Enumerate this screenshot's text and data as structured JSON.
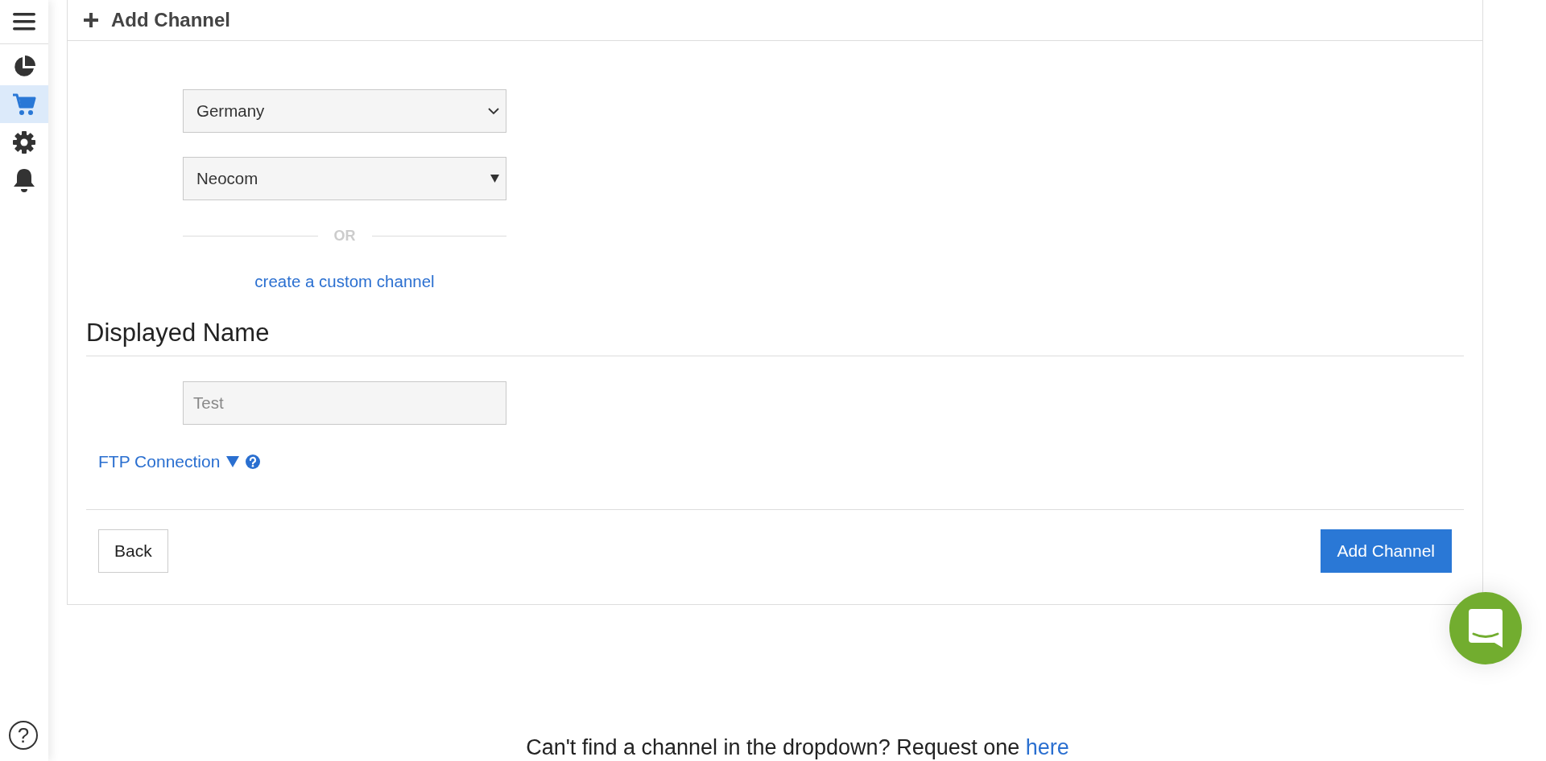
{
  "sidebar": {
    "items": [
      {
        "kind": "menu",
        "selected": false
      },
      {
        "kind": "pie",
        "selected": false
      },
      {
        "kind": "cart",
        "selected": true
      },
      {
        "kind": "gear",
        "selected": false
      },
      {
        "kind": "bell",
        "selected": false
      }
    ],
    "help": "?"
  },
  "card": {
    "title": "Add Channel",
    "country_select": {
      "value": "Germany"
    },
    "channel_select": {
      "value": "Neocom"
    },
    "divider_label": "OR",
    "custom_link": "create a custom channel",
    "section_title": "Displayed Name",
    "name_field": {
      "placeholder": "Test"
    },
    "ftp_toggle": {
      "label": "FTP Connection",
      "expanded": false
    },
    "buttons": [
      {
        "label": "Back",
        "kind": "secondary"
      },
      {
        "label": "Add Channel",
        "kind": "primary"
      }
    ]
  },
  "footer": {
    "text": "Can't find a channel in the dropdown? Request one",
    "link": "here"
  }
}
